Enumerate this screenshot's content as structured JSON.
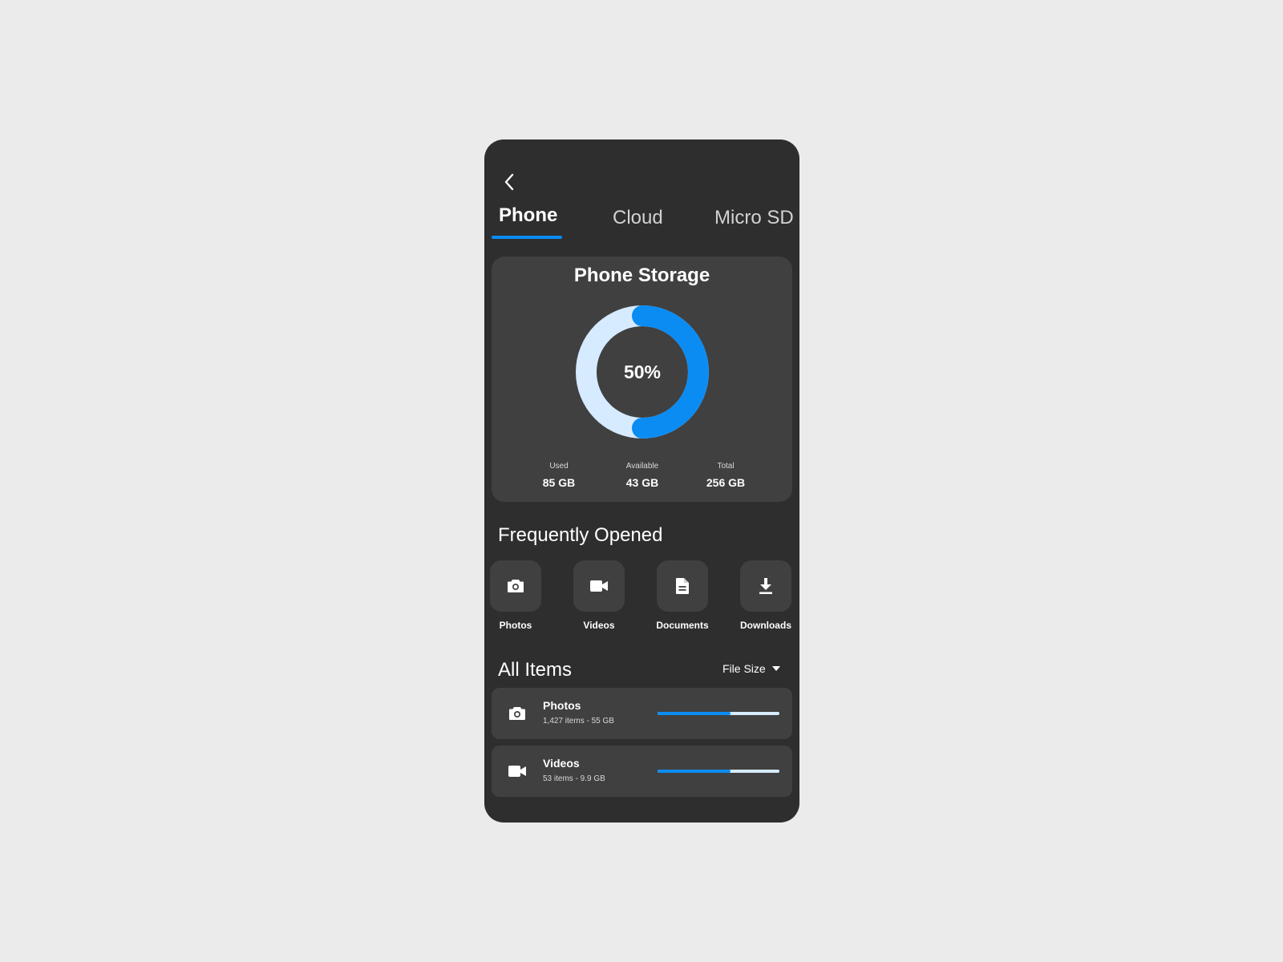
{
  "colors": {
    "page_bg": "#ebebeb",
    "phone_bg": "#2e2e2e",
    "card_bg": "#404040",
    "accent": "#0a8cf3",
    "track_light": "#d6ebff"
  },
  "header": {
    "back_icon": "chevron-left-icon"
  },
  "tabs": [
    {
      "label": "Phone",
      "active": true
    },
    {
      "label": "Cloud",
      "active": false
    },
    {
      "label": "Micro SD",
      "active": false
    }
  ],
  "storage": {
    "title": "Phone Storage",
    "percent_label": "50%",
    "used_fraction": 0.5,
    "stats": [
      {
        "label": "Used",
        "value": "85 GB"
      },
      {
        "label": "Available",
        "value": "43 GB"
      },
      {
        "label": "Total",
        "value": "256 GB"
      }
    ]
  },
  "frequently_opened": {
    "title": "Frequently Opened",
    "items": [
      {
        "label": "Photos",
        "icon": "camera-icon"
      },
      {
        "label": "Videos",
        "icon": "video-camera-icon"
      },
      {
        "label": "Documents",
        "icon": "document-icon"
      },
      {
        "label": "Downloads",
        "icon": "download-icon"
      }
    ]
  },
  "all_items": {
    "title": "All Items",
    "sort_label": "File Size",
    "items": [
      {
        "name": "Photos",
        "meta": "1,427 items - 55 GB",
        "icon": "camera-icon",
        "fill_fraction": 0.6
      },
      {
        "name": "Videos",
        "meta": "53 items - 9.9 GB",
        "icon": "video-camera-icon",
        "fill_fraction": 0.6
      }
    ]
  }
}
